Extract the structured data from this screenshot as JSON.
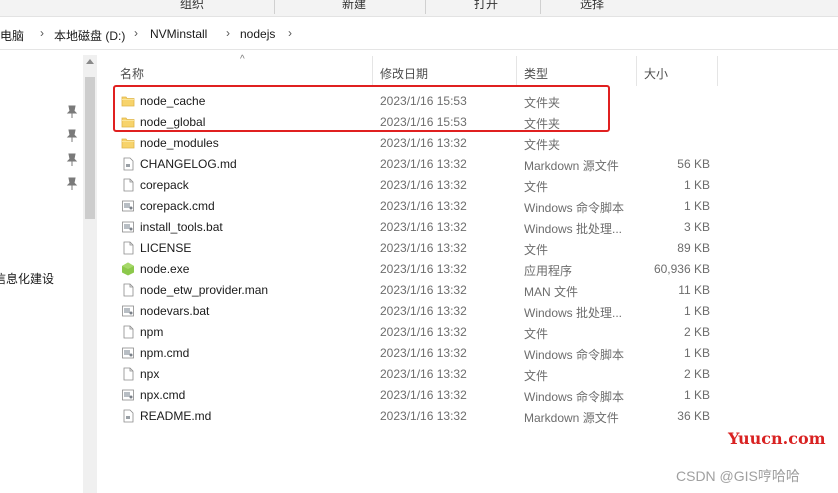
{
  "ribbon": {
    "groups": [
      "组织",
      "新建",
      "打开",
      "选择"
    ]
  },
  "address": {
    "crumbs": [
      "此电脑",
      "本地磁盘 (D:)",
      "NVMinstall",
      "nodejs"
    ]
  },
  "nav": {
    "visible_item": "信息化建设"
  },
  "columns": {
    "name": "名称",
    "date": "修改日期",
    "type": "类型",
    "size": "大小"
  },
  "files": [
    {
      "name": "node_cache",
      "date": "2023/1/16 15:53",
      "type": "文件夹",
      "size": "",
      "icon": "folder-icon"
    },
    {
      "name": "node_global",
      "date": "2023/1/16 15:53",
      "type": "文件夹",
      "size": "",
      "icon": "folder-icon"
    },
    {
      "name": "node_modules",
      "date": "2023/1/16 13:32",
      "type": "文件夹",
      "size": "",
      "icon": "folder-icon"
    },
    {
      "name": "CHANGELOG.md",
      "date": "2023/1/16 13:32",
      "type": "Markdown 源文件",
      "size": "56 KB",
      "icon": "markdown-file-icon"
    },
    {
      "name": "corepack",
      "date": "2023/1/16 13:32",
      "type": "文件",
      "size": "1 KB",
      "icon": "file-icon"
    },
    {
      "name": "corepack.cmd",
      "date": "2023/1/16 13:32",
      "type": "Windows 命令脚本",
      "size": "1 KB",
      "icon": "script-file-icon"
    },
    {
      "name": "install_tools.bat",
      "date": "2023/1/16 13:32",
      "type": "Windows 批处理...",
      "size": "3 KB",
      "icon": "script-file-icon"
    },
    {
      "name": "LICENSE",
      "date": "2023/1/16 13:32",
      "type": "文件",
      "size": "89 KB",
      "icon": "file-icon"
    },
    {
      "name": "node.exe",
      "date": "2023/1/16 13:32",
      "type": "应用程序",
      "size": "60,936 KB",
      "icon": "nodejs-icon"
    },
    {
      "name": "node_etw_provider.man",
      "date": "2023/1/16 13:32",
      "type": "MAN 文件",
      "size": "11 KB",
      "icon": "file-icon"
    },
    {
      "name": "nodevars.bat",
      "date": "2023/1/16 13:32",
      "type": "Windows 批处理...",
      "size": "1 KB",
      "icon": "script-file-icon"
    },
    {
      "name": "npm",
      "date": "2023/1/16 13:32",
      "type": "文件",
      "size": "2 KB",
      "icon": "file-icon"
    },
    {
      "name": "npm.cmd",
      "date": "2023/1/16 13:32",
      "type": "Windows 命令脚本",
      "size": "1 KB",
      "icon": "script-file-icon"
    },
    {
      "name": "npx",
      "date": "2023/1/16 13:32",
      "type": "文件",
      "size": "2 KB",
      "icon": "file-icon"
    },
    {
      "name": "npx.cmd",
      "date": "2023/1/16 13:32",
      "type": "Windows 命令脚本",
      "size": "1 KB",
      "icon": "script-file-icon"
    },
    {
      "name": "README.md",
      "date": "2023/1/16 13:32",
      "type": "Markdown 源文件",
      "size": "36 KB",
      "icon": "markdown-file-icon"
    }
  ],
  "watermarks": {
    "site": "Yuucn.com",
    "author": "CSDN @GIS哼哈哈"
  },
  "colors": {
    "highlight_border": "#e02020",
    "folder": "#f7d36b",
    "node_green": "#8cc84b"
  }
}
